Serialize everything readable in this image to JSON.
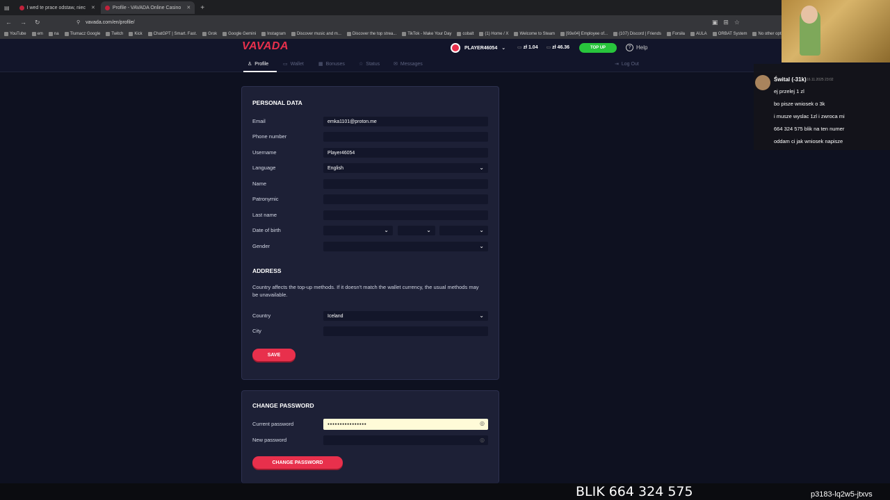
{
  "browser": {
    "tabs": [
      {
        "title": "I wed te prace odstaw, niec",
        "active": false
      },
      {
        "title": "Profile - VAVADA Online Casino",
        "active": true
      }
    ],
    "url": "vavada.com/en/profile/",
    "bookmarks": [
      "YouTube",
      "em",
      "na",
      "Tłumacz Google",
      "Twitch",
      "Kick",
      "ChatGPT | Smart. Fast.",
      "Grok",
      "Google Gemini",
      "Instagram",
      "Discover music and m...",
      "Discover the top strea...",
      "TikTok - Make Your Day",
      "cobalt",
      "(1) Home / X",
      "Welcome to Steam",
      "[93e04] Employee of...",
      "(107) Discord | Friends",
      "Forsiła",
      "AULA",
      "ORBAT System",
      "No other opti"
    ]
  },
  "header": {
    "logo": "VAVADA",
    "player": "PLAYER46054",
    "balance1": "zł 1.04",
    "balance2": "zł 46.36",
    "topup": "TOP UP",
    "help": "Help"
  },
  "subnav": {
    "profile": "Profile",
    "wallet": "Wallet",
    "bonuses": "Bonuses",
    "status": "Status",
    "messages": "Messages",
    "logout": "Log Out"
  },
  "personal": {
    "title": "PERSONAL DATA",
    "email_label": "Email",
    "email_value": "emka1101@proton.me",
    "phone_label": "Phone number",
    "username_label": "Username",
    "username_value": "Player46054",
    "language_label": "Language",
    "language_value": "English",
    "name_label": "Name",
    "patronymic_label": "Patronymic",
    "lastname_label": "Last name",
    "dob_label": "Date of birth",
    "gender_label": "Gender"
  },
  "address": {
    "title": "ADDRESS",
    "note": "Country affects the top-up methods. If it doesn't match the wallet currency, the usual methods may be unavailable.",
    "country_label": "Country",
    "country_value": "Iceland",
    "city_label": "City",
    "save": "SAVE"
  },
  "password": {
    "title": "CHANGE PASSWORD",
    "current_label": "Current password",
    "current_value": "●●●●●●●●●●●●●●●●",
    "new_label": "New password",
    "button": "CHANGE PASSWORD"
  },
  "chat": {
    "user": "Śwital (-31k)",
    "time": "16.11.2025 23:02",
    "messages": [
      "ej przelej 1 zl",
      "bo pisze wniosek o 3k",
      "i musze wyslac 1zl i zwroca mi",
      "664 324 575 blik na ten numer",
      "oddam ci jak wniosek napisze"
    ]
  },
  "overlay": {
    "blik": "BLIK 664 324 575",
    "code": "p3183-lq2w5-jtxvs"
  }
}
